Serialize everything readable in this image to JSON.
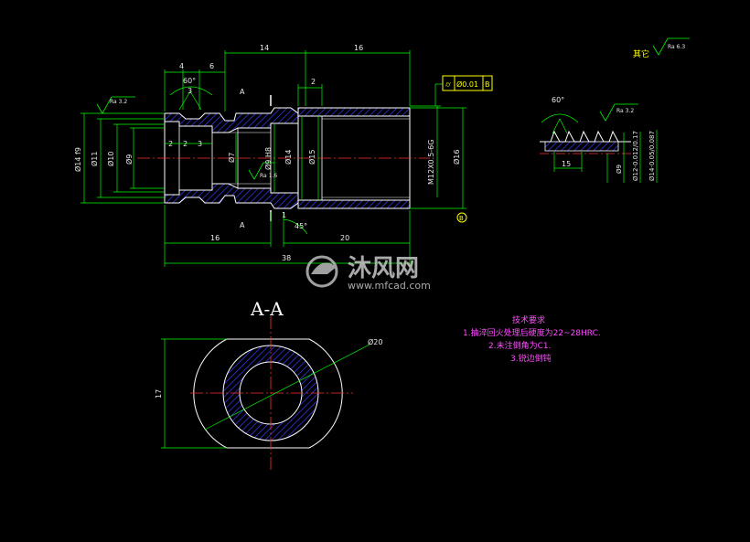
{
  "colors": {
    "background": "#000000",
    "outline": "#ffffff",
    "dimension": "#00ff00",
    "centerline": "#ff3030",
    "hatch": "#3a3aff",
    "annotation": "#ff4cff",
    "tolerance": "#ffff00"
  },
  "main_view": {
    "dims_top": [
      "4",
      "6",
      "14",
      "16",
      "2"
    ],
    "angle_top": "60°",
    "dim_3": "3",
    "section_mark": "A",
    "dims_left": [
      "Ø14 f9",
      "Ø11",
      "Ø10",
      "Ø9"
    ],
    "inner_dims": [
      "2",
      "2",
      "3"
    ],
    "mid_dims": [
      "Ø7",
      "Ø9 H8",
      "Ø14",
      "Ø15"
    ],
    "thread_label": "M12X0.5-6G",
    "dim_16": "Ø16",
    "dims_bottom": [
      "16",
      "20",
      "38"
    ],
    "angle_bottom": "45°",
    "dim_1": "1",
    "ra_left": "Ra 3.2",
    "ra_mid": "Ra 1.6",
    "tolerance": "Ø0.01",
    "tolerance_symbol": "⌭",
    "datum": "B",
    "datum_ref": "B"
  },
  "detail_view": {
    "angle": "60°",
    "ra": "Ra 3.2",
    "dim_15": "15",
    "dims": [
      "Ø9",
      "Ø12-0.012/0.17",
      "Ø14-0.05/0.087"
    ]
  },
  "other_roughness": "其它",
  "other_ra": "Ra 6.3",
  "section_view": {
    "title": "A-A",
    "dia": "Ø20",
    "height": "17"
  },
  "tech_requirements": {
    "title": "技术要求",
    "items": [
      "1.抽淬回火处理后硬度为22~28HRC.",
      "2.未注倒角为C1.",
      "3.锐边倒钝"
    ]
  },
  "watermark": {
    "text": "沐风网",
    "url": "www.mfcad.com"
  }
}
